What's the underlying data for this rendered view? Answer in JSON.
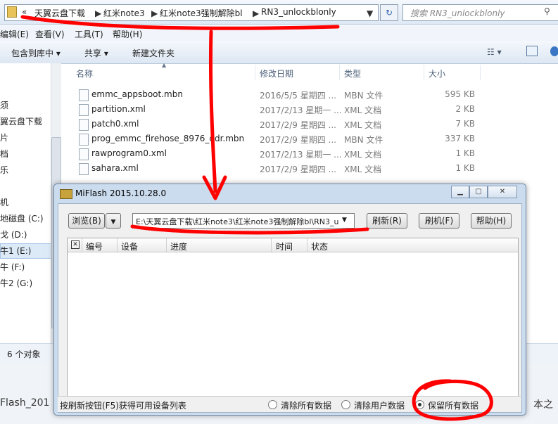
{
  "explorer": {
    "breadcrumb": [
      "«",
      "天翼云盘下载",
      "红米note3",
      "红米note3强制解除bl",
      "RN3_unlockblonly"
    ],
    "search_placeholder": "搜索 RN3_unlockblonly",
    "menu": [
      "编辑(E)",
      "查看(V)",
      "工具(T)",
      "帮助(H)"
    ],
    "toolbar": {
      "include": "包含到库中 ▾",
      "share": "共享 ▾",
      "new_folder": "新建文件夹"
    },
    "columns": {
      "name": "名称",
      "date": "修改日期",
      "type": "类型",
      "size": "大小"
    },
    "files": [
      {
        "name": "emmc_appsboot.mbn",
        "date": "2016/5/5 星期四 ...",
        "type": "MBN 文件",
        "size": "595 KB"
      },
      {
        "name": "partition.xml",
        "date": "2017/2/13 星期一 ...",
        "type": "XML 文档",
        "size": "2 KB"
      },
      {
        "name": "patch0.xml",
        "date": "2017/2/9 星期四 ...",
        "type": "XML 文档",
        "size": "7 KB"
      },
      {
        "name": "prog_emmc_firehose_8976_ddr.mbn",
        "date": "2017/2/9 星期四 ...",
        "type": "MBN 文件",
        "size": "337 KB"
      },
      {
        "name": "rawprogram0.xml",
        "date": "2017/2/13 星期一 ...",
        "type": "XML 文档",
        "size": "1 KB"
      },
      {
        "name": "sahara.xml",
        "date": "2017/2/9 星期四 ...",
        "type": "XML 文档",
        "size": "1 KB"
      }
    ],
    "nav": [
      "须",
      "翼云盘下载",
      "片",
      "档",
      "乐",
      "机",
      "地磁盘 (C:)",
      "戈 (D:)",
      "牛1 (E:)",
      "牛 (F:)",
      "牛2 (G:)"
    ],
    "status": "6 个对象",
    "bottom_left": "Flash_201",
    "bottom_right": "本之"
  },
  "miflash": {
    "title": "MiFlash 2015.10.28.0",
    "browse": "浏览(B)",
    "path": "E:\\天翼云盘下载\\红米note3\\红米note3强制解除bl\\RN3_u",
    "refresh": "刷新(R)",
    "flash": "刷机(F)",
    "help": "帮助(H)",
    "grid_headers": [
      "编号",
      "设备",
      "进度",
      "时间",
      "状态"
    ],
    "status_hint": "按刷新按钮(F5)获得可用设备列表",
    "options": [
      {
        "label": "清除所有数据",
        "selected": false
      },
      {
        "label": "清除用户数据",
        "selected": false
      },
      {
        "label": "保留所有数据",
        "selected": true
      }
    ]
  },
  "colors": {
    "annotation": "#ff0000",
    "accent": "#3567b0"
  }
}
